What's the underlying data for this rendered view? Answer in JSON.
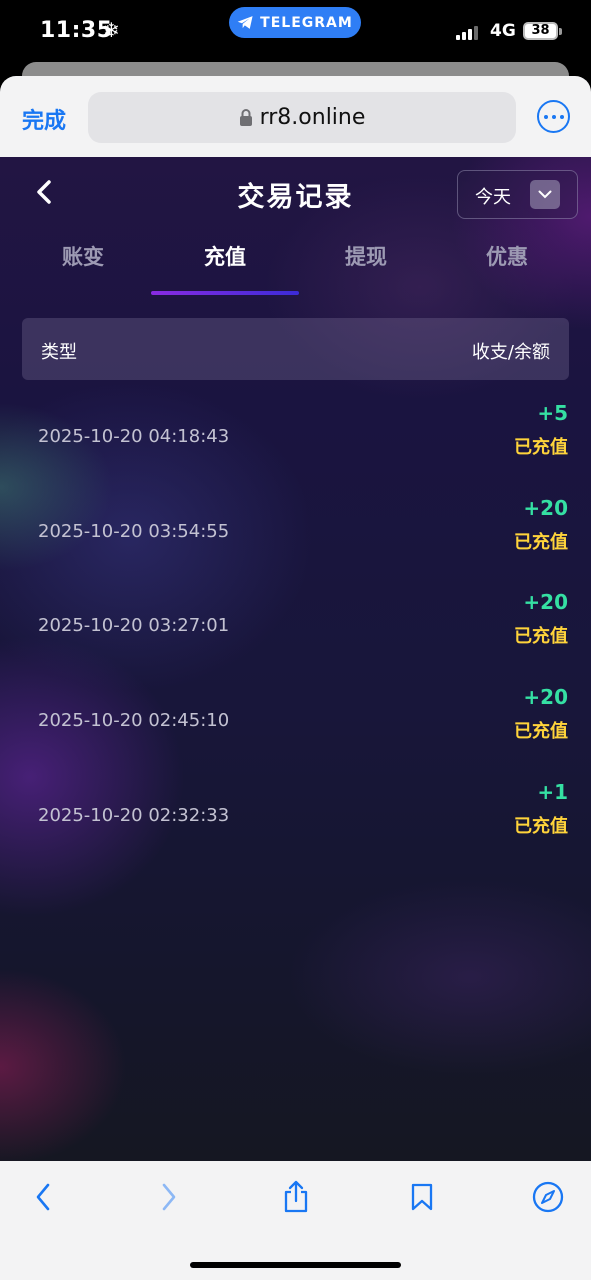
{
  "status_bar": {
    "time": "11:35",
    "weather_icon": "snowflake-icon",
    "pill_label": "TELEGRAM",
    "network": "4G",
    "battery": "38",
    "signal_bars": 3
  },
  "browser": {
    "done_label": "完成",
    "url": "rr8.online",
    "accent": "#1977f3"
  },
  "page": {
    "title": "交易记录",
    "date_filter": "今天",
    "tabs": [
      {
        "label": "账变",
        "active": false
      },
      {
        "label": "充值",
        "active": true
      },
      {
        "label": "提现",
        "active": false
      },
      {
        "label": "优惠",
        "active": false
      }
    ],
    "table": {
      "col_type": "类型",
      "col_amount": "收支/余额"
    },
    "records": [
      {
        "time": "2025-10-20 04:18:43",
        "amount": "+5",
        "status": "已充值"
      },
      {
        "time": "2025-10-20 03:54:55",
        "amount": "+20",
        "status": "已充值"
      },
      {
        "time": "2025-10-20 03:27:01",
        "amount": "+20",
        "status": "已充值"
      },
      {
        "time": "2025-10-20 02:45:10",
        "amount": "+20",
        "status": "已充值"
      },
      {
        "time": "2025-10-20 02:32:33",
        "amount": "+1",
        "status": "已充值"
      }
    ],
    "colors": {
      "amount": "#35e0a3",
      "status": "#ffd43b",
      "tab_underline": "#8a2be2"
    }
  }
}
